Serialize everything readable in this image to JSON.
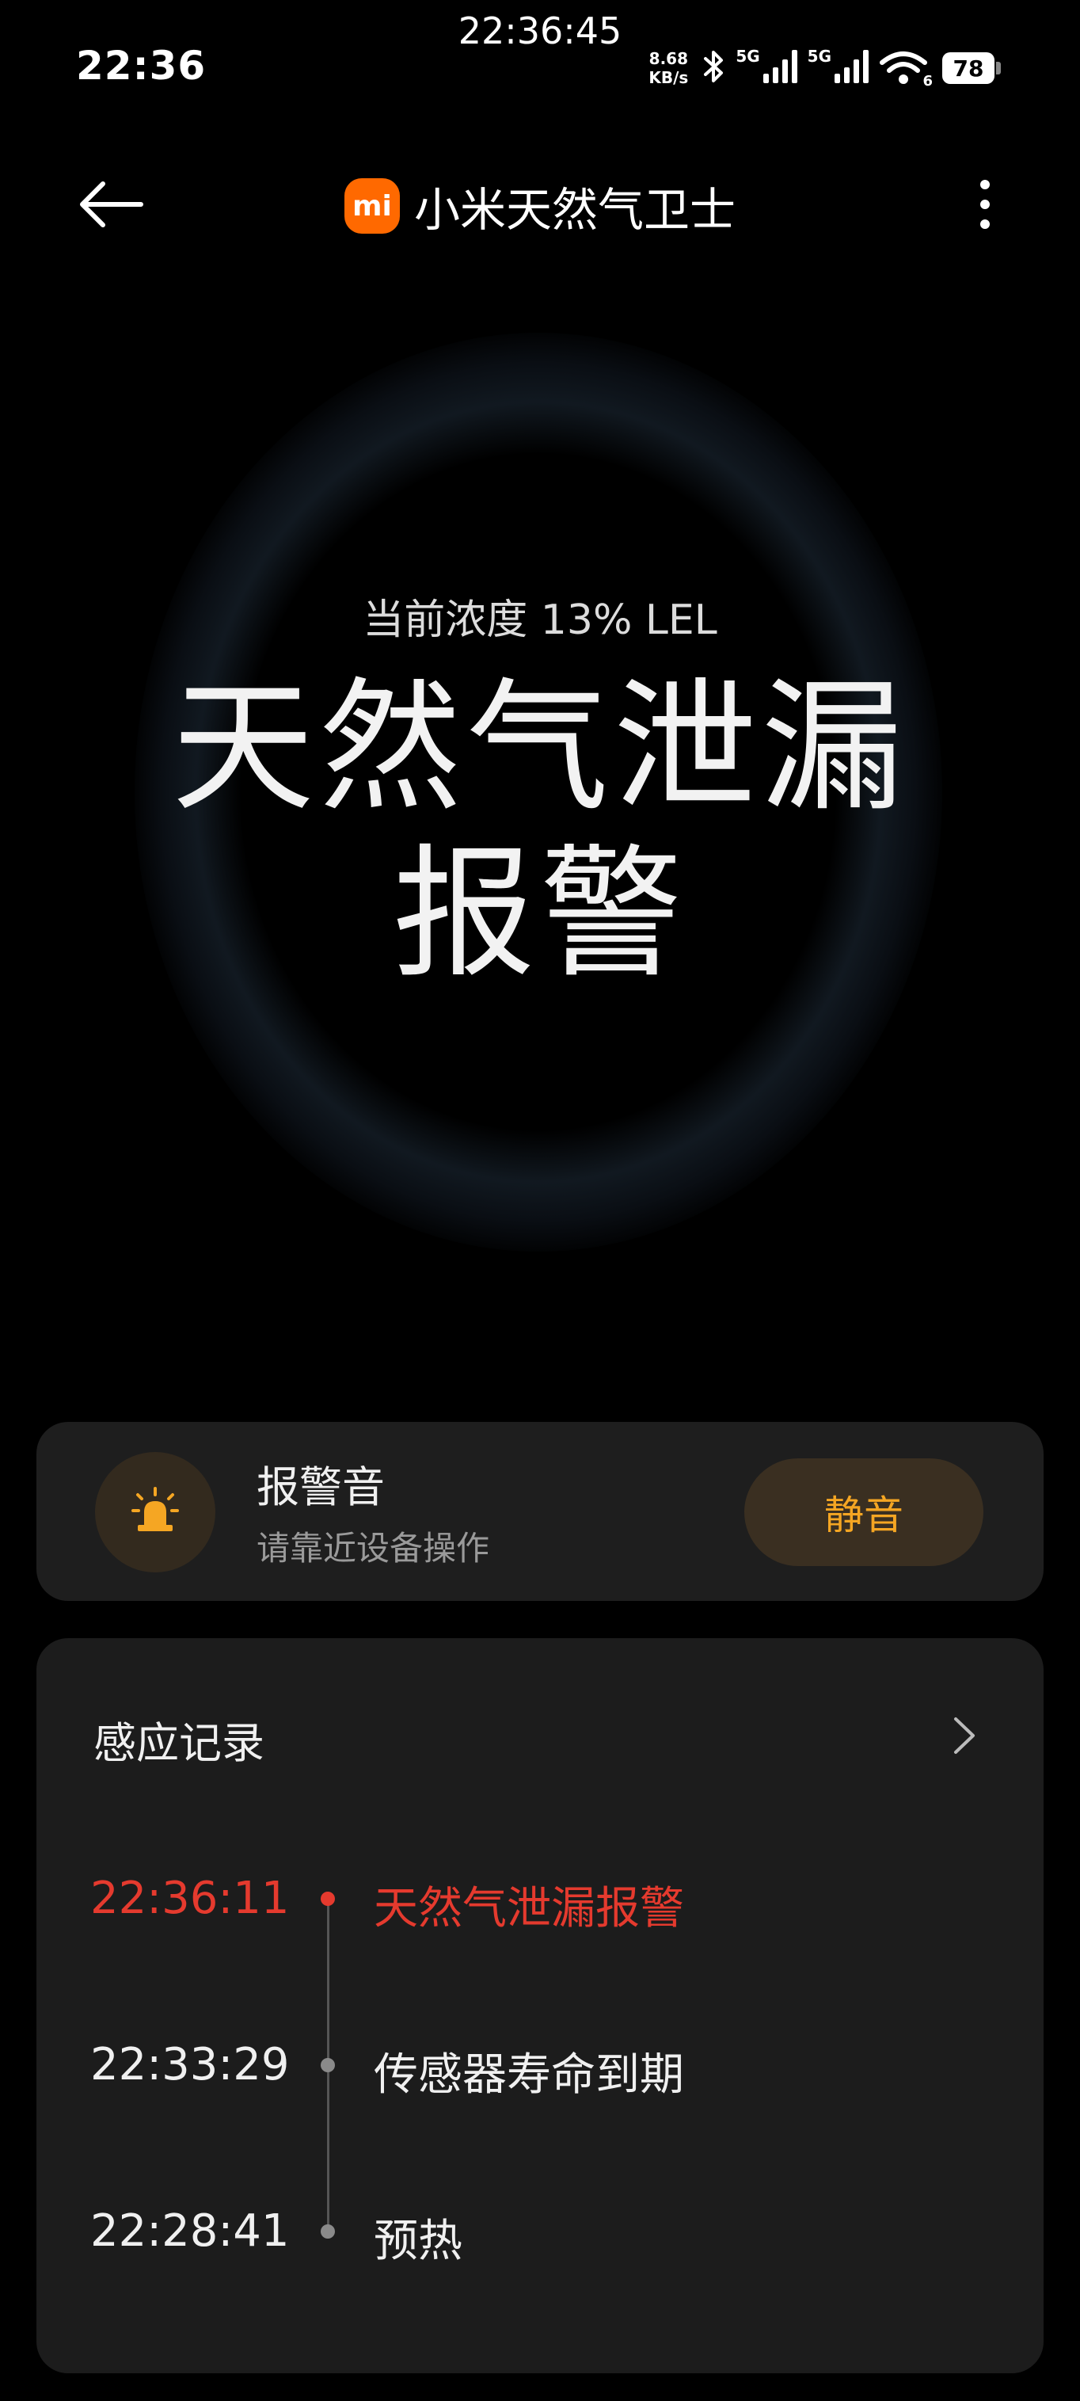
{
  "status_bar": {
    "time": "22:36",
    "capture_time": "22:36:45",
    "net_speed_value": "8.68",
    "net_speed_unit": "KB/s",
    "sim1_label": "5G",
    "sim2_label": "5G",
    "wifi_sub": "6",
    "battery_level": "78"
  },
  "header": {
    "logo_text": "mi",
    "title": "小米天然气卫士"
  },
  "hero": {
    "concentration": "当前浓度 13% LEL",
    "alarm_title": "天然气泄漏报警"
  },
  "sound_card": {
    "title": "报警音",
    "subtitle": "请靠近设备操作",
    "mute_label": "静音"
  },
  "records": {
    "title": "感应记录",
    "items": [
      {
        "time": "22:36:11",
        "event": "天然气泄漏报警",
        "level": "alert"
      },
      {
        "time": "22:33:29",
        "event": "传感器寿命到期",
        "level": "normal"
      },
      {
        "time": "22:28:41",
        "event": "预热",
        "level": "normal"
      }
    ]
  },
  "colors": {
    "accent_orange": "#f5a623",
    "alert_red": "#e53a2e",
    "brand": "#ff6900",
    "card_bg": "#1e1e1e"
  },
  "icons": {
    "back": "arrow-left-icon",
    "more": "more-vertical-icon",
    "alarm": "siren-icon",
    "chevron": "chevron-right-icon",
    "bluetooth": "bluetooth-icon",
    "wifi": "wifi-icon"
  }
}
